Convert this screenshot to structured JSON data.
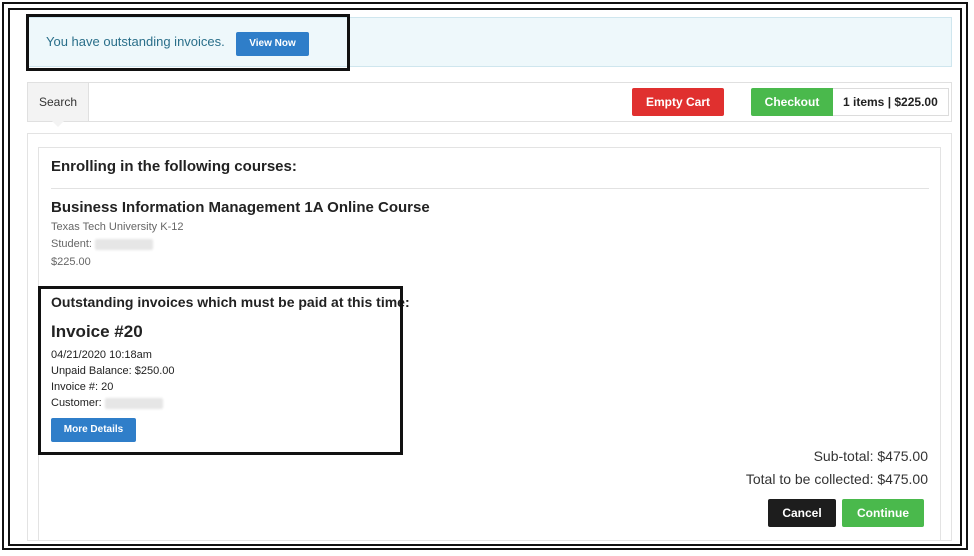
{
  "alert": {
    "message": "You have outstanding invoices.",
    "view_now_label": "View Now"
  },
  "toolbar": {
    "search_tab": "Search",
    "empty_cart_label": "Empty Cart",
    "checkout_label": "Checkout",
    "cart_summary": "1 items | $225.00"
  },
  "enrollment": {
    "heading": "Enrolling in the following courses:",
    "course": {
      "title": "Business Information Management 1A Online Course",
      "provider": "Texas Tech University K-12",
      "student_label": "Student:",
      "price": "$225.00"
    }
  },
  "invoices": {
    "heading": "Outstanding invoices which must be paid at this time:",
    "invoice": {
      "title": "Invoice #20",
      "date": "04/21/2020 10:18am",
      "unpaid_balance": "Unpaid Balance: $250.00",
      "invoice_number": "Invoice #: 20",
      "customer_label": "Customer:",
      "more_details_label": "More Details"
    }
  },
  "totals": {
    "subtotal": "Sub-total: $475.00",
    "total": "Total to be collected: $475.00"
  },
  "actions": {
    "cancel_label": "Cancel",
    "continue_label": "Continue"
  }
}
